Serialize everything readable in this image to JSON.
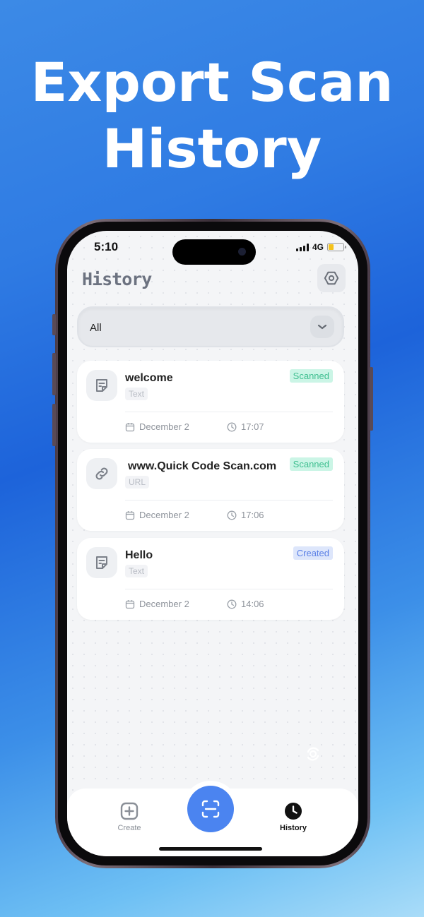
{
  "headline": {
    "line1": "Export Scan",
    "line2": "History"
  },
  "status_bar": {
    "time": "5:10",
    "network": "4G",
    "battery_level": 0.35,
    "battery_color": "#f4c21c"
  },
  "header": {
    "title": "History",
    "settings_icon": "gear-icon"
  },
  "filter": {
    "selected": "All",
    "icon": "chevron-down-icon"
  },
  "history": [
    {
      "title": "welcome",
      "type": "Text",
      "status": "Scanned",
      "date": "December 2",
      "time": "17:07",
      "icon": "note-icon"
    },
    {
      "title": "www.Quick Code Scan.com",
      "type": "URL",
      "status": "Scanned",
      "date": "December 2",
      "time": "17:06",
      "icon": "link-icon"
    },
    {
      "title": "Hello",
      "type": "Text",
      "status": "Created",
      "date": "December 2",
      "time": "14:06",
      "icon": "note-icon"
    }
  ],
  "tabbar": {
    "create_label": "Create",
    "history_label": "History",
    "active": "History",
    "scan_color": "#4b84f0"
  },
  "colors": {
    "scanned_bg": "#cbf5e6",
    "scanned_text": "#3fbf90",
    "created_bg": "#dde6fb",
    "created_text": "#5b80e6"
  }
}
